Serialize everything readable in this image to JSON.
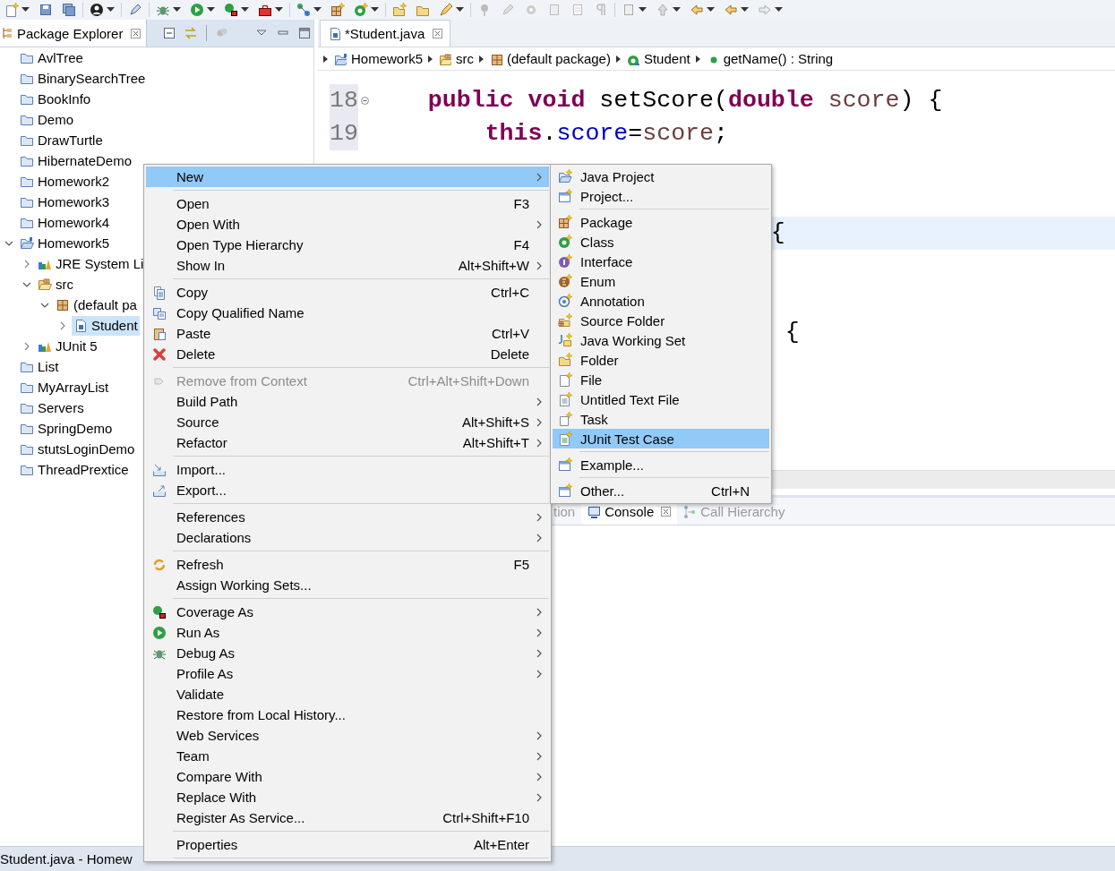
{
  "package_explorer": {
    "tab": {
      "label": "Package Explorer",
      "selected": true
    },
    "tree": [
      {
        "label": "AvlTree",
        "kind": "project",
        "selected": false
      },
      {
        "label": "BinarySearchTree",
        "kind": "project",
        "selected": false
      },
      {
        "label": "BookInfo",
        "kind": "project",
        "selected": false
      },
      {
        "label": "Demo",
        "kind": "project",
        "selected": false
      },
      {
        "label": "DrawTurtle",
        "kind": "project",
        "selected": false
      },
      {
        "label": "HibernateDemo",
        "kind": "project",
        "selected": false
      },
      {
        "label": "Homework2",
        "kind": "project",
        "selected": false
      },
      {
        "label": "Homework3",
        "kind": "project",
        "selected": false
      },
      {
        "label": "Homework4",
        "kind": "project",
        "selected": false
      },
      {
        "label": "Homework5",
        "kind": "project",
        "selected": false,
        "expanded": true,
        "children": [
          {
            "label": "JRE System Li",
            "kind": "library",
            "selected": false,
            "expanded": false
          },
          {
            "label": "src",
            "kind": "source_folder",
            "selected": false,
            "expanded": true,
            "children": [
              {
                "label": "(default pa",
                "kind": "package",
                "selected": false,
                "expanded": true,
                "children": [
                  {
                    "label": "Student",
                    "kind": "class",
                    "selected": true,
                    "expanded": false
                  }
                ]
              }
            ]
          },
          {
            "label": "JUnit 5",
            "kind": "library",
            "selected": false,
            "expanded": false
          }
        ]
      },
      {
        "label": "List",
        "kind": "project",
        "selected": false
      },
      {
        "label": "MyArrayList",
        "kind": "project",
        "selected": false
      },
      {
        "label": "Servers",
        "kind": "project",
        "selected": false
      },
      {
        "label": "SpringDemo",
        "kind": "project",
        "selected": false
      },
      {
        "label": "stutsLoginDemo",
        "kind": "project",
        "selected": false
      },
      {
        "label": "ThreadPrextice",
        "kind": "project",
        "selected": false
      }
    ]
  },
  "editor": {
    "tab": {
      "label": "*Student.java",
      "selected": true
    },
    "breadcrumb": [
      {
        "label": "Homework5",
        "kind": "project"
      },
      {
        "label": "src",
        "kind": "source_folder"
      },
      {
        "label": "(default package)",
        "kind": "package"
      },
      {
        "label": "Student",
        "kind": "class"
      },
      {
        "label": "getName() : String",
        "kind": "method"
      }
    ],
    "lines": [
      {
        "number": "18",
        "current": false,
        "tokens": [
          {
            "text": "public void",
            "kind": "keyword"
          },
          {
            "text": " setScore(",
            "kind": "plain"
          },
          {
            "text": "double ",
            "kind": "keyword"
          },
          {
            "text": "score",
            "kind": "param"
          },
          {
            "text": ") {",
            "kind": "plain"
          }
        ]
      },
      {
        "number": "19",
        "current": false,
        "tokens": [
          {
            "text": "this",
            "kind": "keyword"
          },
          {
            "text": ".",
            "kind": "plain"
          },
          {
            "text": "score",
            "kind": "field"
          },
          {
            "text": "=",
            "kind": "plain"
          },
          {
            "text": "score",
            "kind": "param"
          },
          {
            "text": ";",
            "kind": "plain"
          }
        ]
      }
    ],
    "fragments": [
      {
        "text": "{",
        "current": true
      },
      {
        "text": "{",
        "current": false
      }
    ]
  },
  "bottom_panel": {
    "tabs": [
      {
        "label": "tion",
        "selected": false
      },
      {
        "label": "Console",
        "selected": true
      },
      {
        "label": "Call Hierarchy",
        "selected": false
      }
    ]
  },
  "status_bar": {
    "text": "Student.java - Homew"
  },
  "context_menu": {
    "groups": [
      {
        "items": [
          {
            "label": "New",
            "selected": true,
            "disabled": false,
            "has_submenu": true
          }
        ]
      },
      {
        "items": [
          {
            "label": "Open",
            "shortcut": "F3",
            "selected": false,
            "disabled": false,
            "has_submenu": false
          },
          {
            "label": "Open With",
            "selected": false,
            "disabled": false,
            "has_submenu": true
          },
          {
            "label": "Open Type Hierarchy",
            "shortcut": "F4",
            "selected": false,
            "disabled": false,
            "has_submenu": false
          },
          {
            "label": "Show In",
            "shortcut": "Alt+Shift+W",
            "selected": false,
            "disabled": false,
            "has_submenu": true
          }
        ]
      },
      {
        "items": [
          {
            "label": "Copy",
            "shortcut": "Ctrl+C",
            "selected": false,
            "disabled": false,
            "has_submenu": false
          },
          {
            "label": "Copy Qualified Name",
            "selected": false,
            "disabled": false,
            "has_submenu": false
          },
          {
            "label": "Paste",
            "shortcut": "Ctrl+V",
            "selected": false,
            "disabled": false,
            "has_submenu": false
          },
          {
            "label": "Delete",
            "shortcut": "Delete",
            "selected": false,
            "disabled": false,
            "has_submenu": false
          }
        ]
      },
      {
        "items": [
          {
            "label": "Remove from Context",
            "shortcut": "Ctrl+Alt+Shift+Down",
            "selected": false,
            "disabled": true,
            "has_submenu": false
          },
          {
            "label": "Build Path",
            "selected": false,
            "disabled": false,
            "has_submenu": true
          },
          {
            "label": "Source",
            "shortcut": "Alt+Shift+S",
            "selected": false,
            "disabled": false,
            "has_submenu": true
          },
          {
            "label": "Refactor",
            "shortcut": "Alt+Shift+T",
            "selected": false,
            "disabled": false,
            "has_submenu": true
          }
        ]
      },
      {
        "items": [
          {
            "label": "Import...",
            "selected": false,
            "disabled": false,
            "has_submenu": false
          },
          {
            "label": "Export...",
            "selected": false,
            "disabled": false,
            "has_submenu": false
          }
        ]
      },
      {
        "items": [
          {
            "label": "References",
            "selected": false,
            "disabled": false,
            "has_submenu": true
          },
          {
            "label": "Declarations",
            "selected": false,
            "disabled": false,
            "has_submenu": true
          }
        ]
      },
      {
        "items": [
          {
            "label": "Refresh",
            "shortcut": "F5",
            "selected": false,
            "disabled": false,
            "has_submenu": false
          },
          {
            "label": "Assign Working Sets...",
            "selected": false,
            "disabled": false,
            "has_submenu": false
          }
        ]
      },
      {
        "items": [
          {
            "label": "Coverage As",
            "selected": false,
            "disabled": false,
            "has_submenu": true
          },
          {
            "label": "Run As",
            "selected": false,
            "disabled": false,
            "has_submenu": true
          },
          {
            "label": "Debug As",
            "selected": false,
            "disabled": false,
            "has_submenu": true
          },
          {
            "label": "Profile As",
            "selected": false,
            "disabled": false,
            "has_submenu": true
          },
          {
            "label": "Validate",
            "selected": false,
            "disabled": false,
            "has_submenu": false
          },
          {
            "label": "Restore from Local History...",
            "selected": false,
            "disabled": false,
            "has_submenu": false
          },
          {
            "label": "Web Services",
            "selected": false,
            "disabled": false,
            "has_submenu": true
          },
          {
            "label": "Team",
            "selected": false,
            "disabled": false,
            "has_submenu": true
          },
          {
            "label": "Compare With",
            "selected": false,
            "disabled": false,
            "has_submenu": true
          },
          {
            "label": "Replace With",
            "selected": false,
            "disabled": false,
            "has_submenu": true
          },
          {
            "label": "Register As Service...",
            "shortcut": "Ctrl+Shift+F10",
            "selected": false,
            "disabled": false,
            "has_submenu": false
          }
        ]
      },
      {
        "items": [
          {
            "label": "Properties",
            "shortcut": "Alt+Enter",
            "selected": false,
            "disabled": false,
            "has_submenu": false
          }
        ]
      }
    ]
  },
  "submenu": {
    "groups": [
      {
        "items": [
          {
            "label": "Java Project",
            "selected": false
          },
          {
            "label": "Project...",
            "selected": false
          }
        ]
      },
      {
        "items": [
          {
            "label": "Package",
            "selected": false
          },
          {
            "label": "Class",
            "selected": false
          },
          {
            "label": "Interface",
            "selected": false
          },
          {
            "label": "Enum",
            "selected": false
          },
          {
            "label": "Annotation",
            "selected": false
          },
          {
            "label": "Source Folder",
            "selected": false
          },
          {
            "label": "Java Working Set",
            "selected": false
          },
          {
            "label": "Folder",
            "selected": false
          },
          {
            "label": "File",
            "selected": false
          },
          {
            "label": "Untitled Text File",
            "selected": false
          },
          {
            "label": "Task",
            "selected": false
          },
          {
            "label": "JUnit Test Case",
            "selected": true
          }
        ]
      },
      {
        "items": [
          {
            "label": "Example...",
            "selected": false
          }
        ]
      },
      {
        "items": [
          {
            "label": "Other...",
            "shortcut": "Ctrl+N",
            "selected": false
          }
        ]
      }
    ]
  }
}
